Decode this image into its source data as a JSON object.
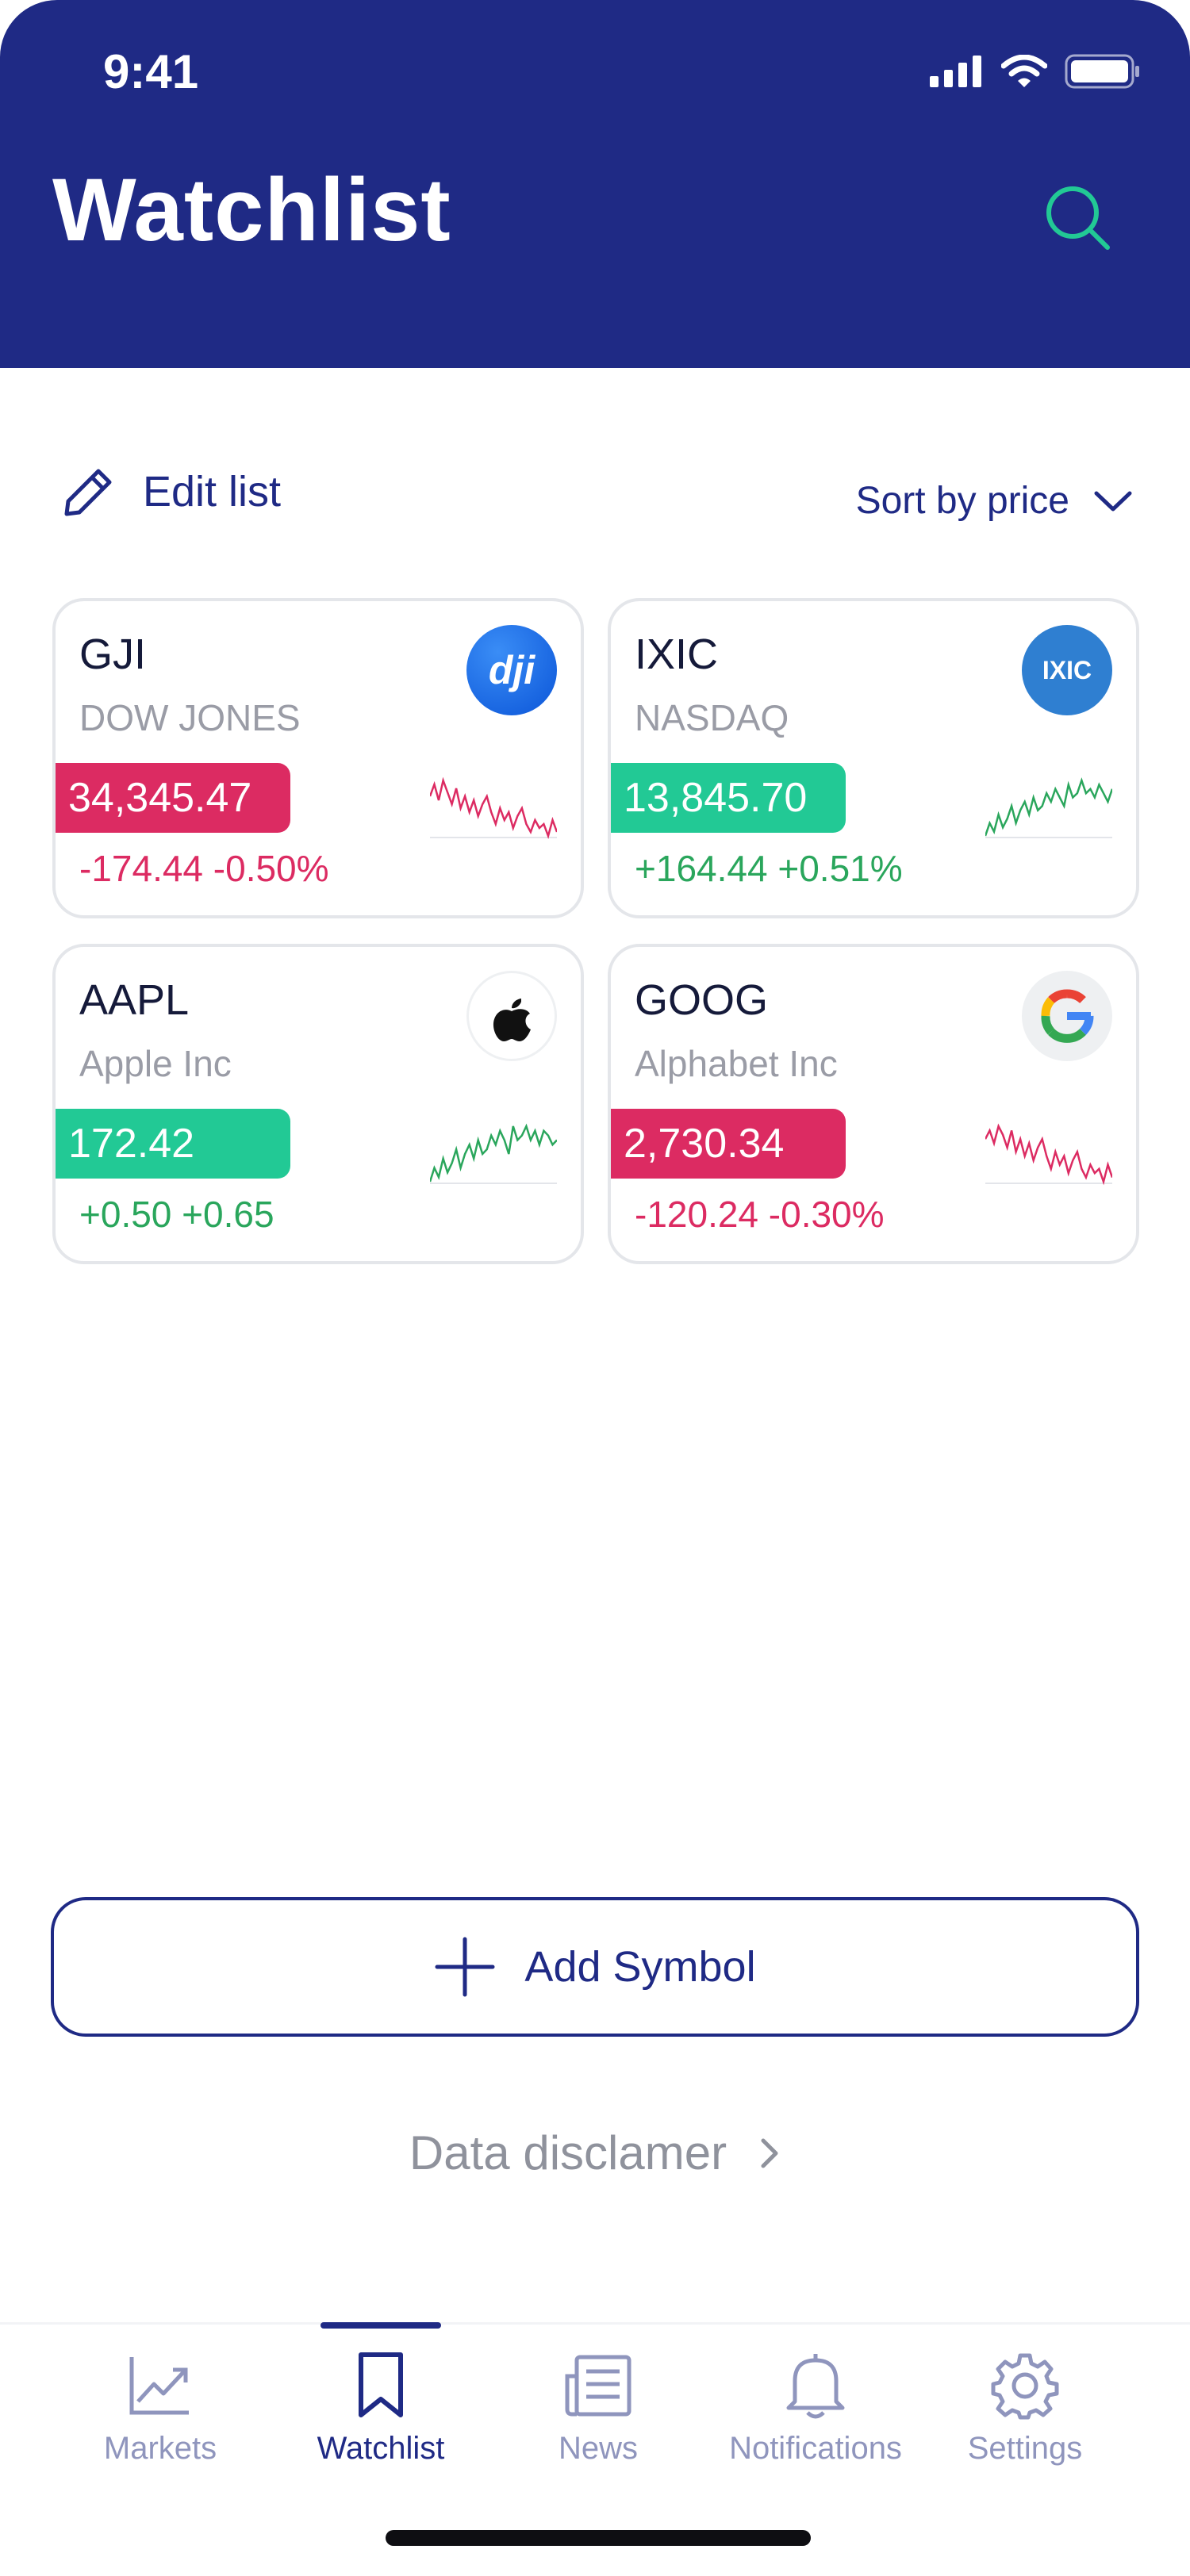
{
  "status_bar": {
    "time": "9:41"
  },
  "header": {
    "title": "Watchlist"
  },
  "toolbar": {
    "edit_label": "Edit list",
    "sort_label": "Sort by price"
  },
  "cards": [
    {
      "symbol": "GJI",
      "company": "DOW JONES",
      "price": "34,345.47",
      "change": "-174.44 -0.50%",
      "trend": "down",
      "logo": "dji-logo",
      "logo_text": "dji",
      "sparkline": [
        5,
        2,
        6,
        1,
        4,
        7,
        3,
        8,
        5,
        9,
        6,
        10,
        7,
        5,
        9,
        12,
        8,
        11,
        9,
        13,
        10,
        8,
        12,
        14,
        11,
        13,
        12,
        15,
        11,
        14
      ]
    },
    {
      "symbol": "IXIC",
      "company": "NASDAQ",
      "price": "13,845.70",
      "change": "+164.44 +0.51%",
      "trend": "up",
      "logo": "ixic-logo",
      "logo_text": "IXIC",
      "sparkline": [
        15,
        12,
        14,
        10,
        13,
        11,
        8,
        12,
        9,
        7,
        10,
        6,
        9,
        8,
        5,
        7,
        4,
        6,
        8,
        3,
        6,
        5,
        2,
        5,
        4,
        6,
        3,
        5,
        7,
        4
      ]
    },
    {
      "symbol": "AAPL",
      "company": "Apple Inc",
      "price": "172.42",
      "change": "+0.50 +0.65",
      "trend": "up",
      "logo": "apple-logo",
      "logo_text": "",
      "sparkline": [
        14,
        11,
        13,
        9,
        12,
        10,
        7,
        11,
        8,
        6,
        9,
        5,
        8,
        7,
        4,
        6,
        3,
        5,
        8,
        2,
        5,
        4,
        2,
        5,
        3,
        6,
        3,
        4,
        6,
        5
      ]
    },
    {
      "symbol": "GOOG",
      "company": "Alphabet Inc",
      "price": "2,730.34",
      "change": "-120.24 -0.30%",
      "trend": "down",
      "logo": "google-logo",
      "logo_text": "",
      "sparkline": [
        4,
        2,
        5,
        1,
        3,
        6,
        2,
        7,
        4,
        8,
        5,
        9,
        6,
        4,
        8,
        11,
        7,
        10,
        8,
        12,
        9,
        7,
        11,
        13,
        10,
        12,
        11,
        14,
        10,
        13
      ]
    }
  ],
  "add_button": {
    "label": "Add Symbol"
  },
  "disclaimer": {
    "label": "Data disclamer"
  },
  "tabs": [
    {
      "label": "Markets",
      "icon": "markets-icon"
    },
    {
      "label": "Watchlist",
      "icon": "bookmark-icon"
    },
    {
      "label": "News",
      "icon": "news-icon"
    },
    {
      "label": "Notifications",
      "icon": "bell-icon"
    },
    {
      "label": "Settings",
      "icon": "gear-icon"
    }
  ],
  "colors": {
    "brand": "#1f2a85",
    "accent": "#22c995",
    "negative": "#dc2b62",
    "positive": "#2aa65c"
  }
}
